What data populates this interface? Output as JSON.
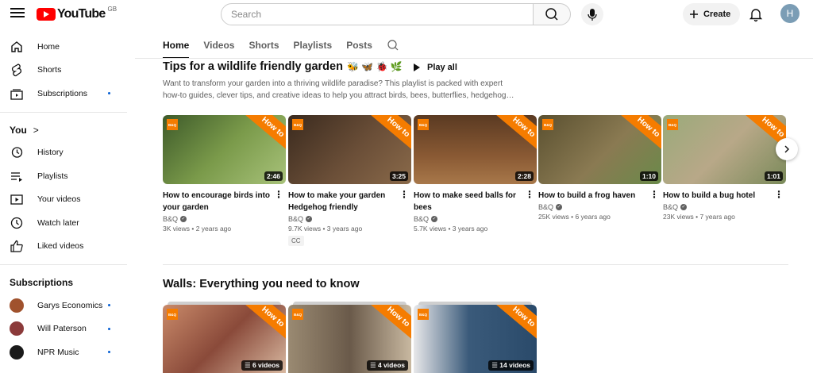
{
  "header": {
    "logo_text": "YouTube",
    "region": "GB",
    "search_placeholder": "Search",
    "create_label": "Create",
    "avatar_letter": "H"
  },
  "sidebar": {
    "main": [
      {
        "label": "Home",
        "icon": "home-icon"
      },
      {
        "label": "Shorts",
        "icon": "shorts-icon"
      },
      {
        "label": "Subscriptions",
        "icon": "subscriptions-icon",
        "dot": true
      }
    ],
    "you_heading": "You",
    "you_chevron": ">",
    "you_items": [
      {
        "label": "History",
        "icon": "history-icon"
      },
      {
        "label": "Playlists",
        "icon": "playlists-icon"
      },
      {
        "label": "Your videos",
        "icon": "your-videos-icon"
      },
      {
        "label": "Watch later",
        "icon": "watch-later-icon"
      },
      {
        "label": "Liked videos",
        "icon": "liked-icon"
      }
    ],
    "subscriptions_heading": "Subscriptions",
    "subscriptions": [
      {
        "label": "Garys Economics",
        "color": "#a0522d"
      },
      {
        "label": "Will Paterson",
        "color": "#8b3a3a"
      },
      {
        "label": "NPR Music",
        "color": "#1a1a1a"
      }
    ]
  },
  "tabs": [
    "Home",
    "Videos",
    "Shorts",
    "Playlists",
    "Posts"
  ],
  "section1": {
    "title": "Tips for a wildlife friendly garden",
    "emojis": "🐝 🦋 🐞 🌿",
    "play_all": "Play all",
    "description_line1": "Want to transform your garden into a thriving wildlife paradise? This playlist is packed with expert",
    "description_line2": "how-to guides, clever tips, and creative ideas to help you attract birds, bees, butterflies, hedgehog…",
    "videos": [
      {
        "title": "How to encourage birds into your garden",
        "channel": "B&Q",
        "meta": "3K views • 2 years ago",
        "duration": "2:46",
        "bg": "#5a7a3a",
        "cc": ""
      },
      {
        "title": "How to make your garden Hedgehog friendly",
        "channel": "B&Q",
        "meta": "9.7K views • 3 years ago",
        "duration": "3:25",
        "bg": "#5b4030",
        "cc": "CC"
      },
      {
        "title": "How to make seed balls for bees",
        "channel": "B&Q",
        "meta": "5.7K views • 3 years ago",
        "duration": "2:28",
        "bg": "#6b4a2e",
        "cc": ""
      },
      {
        "title": "How to build a frog haven",
        "channel": "B&Q",
        "meta": "25K views • 6 years ago",
        "duration": "1:10",
        "bg": "#7a6a42",
        "cc": ""
      },
      {
        "title": "How to build a bug hotel",
        "channel": "B&Q",
        "meta": "23K views • 7 years ago",
        "duration": "1:01",
        "bg": "#8a9a6a",
        "cc": ""
      }
    ],
    "brand_badge": "B&Q",
    "howto_label": "How to"
  },
  "section2": {
    "title": "Walls: Everything you need to know",
    "playlists": [
      {
        "count": "6 videos",
        "bg": "#b06a50"
      },
      {
        "count": "4 videos",
        "bg": "#8a7a6a"
      },
      {
        "count": "14 videos",
        "bg": "#3a5a7a"
      }
    ]
  },
  "colors": {
    "accent": "#ff0000",
    "brand_orange": "#f57c00",
    "dot_blue": "#065fd4"
  }
}
